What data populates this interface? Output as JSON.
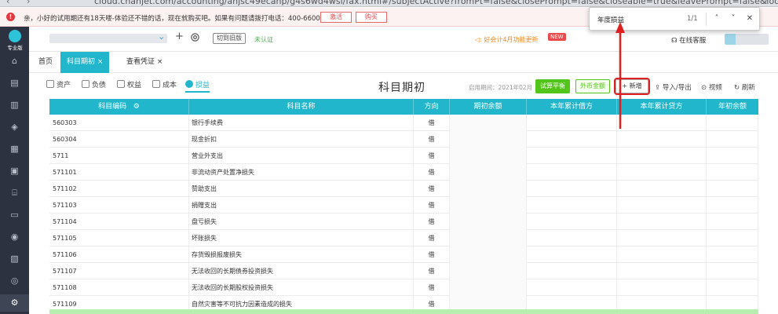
{
  "browser": {
    "url": "cloud.chanjet.com/accounting/anjsc49ecanp/g4s6wd4wsl/fax.html#/subjectActive?fromPt=false&closePrompt=false&closeable=true&leavePrompt=false&lock=false&pageId=subject&pa..."
  },
  "notice": {
    "text": "亲，小好的试用期还有18天喽-体验还不错的话，现在就购买吧。如果有问题请拨打电话：400-6600-566",
    "activate_label": "激活",
    "buy_label": "购买"
  },
  "sidebar": {
    "logo_label": "专业版"
  },
  "header": {
    "switch_label": "切到旧版",
    "unverified_label": "未认证",
    "promo_text": "好会计4月功能更新",
    "new_badge": "NEW",
    "support_label": "在线客服"
  },
  "tabs": [
    {
      "label": "首页"
    },
    {
      "label": "科目期初"
    },
    {
      "label": "查看凭证"
    }
  ],
  "subtabs": [
    {
      "label": "资产"
    },
    {
      "label": "负债"
    },
    {
      "label": "权益"
    },
    {
      "label": "成本"
    },
    {
      "label": "损益"
    }
  ],
  "toolbar": {
    "title": "科目期初",
    "period": "启用期间：2021年02月",
    "trial_balance_label": "试算平衡",
    "foreign_currency_label": "外币金额",
    "add_label": "+ 新增",
    "import_export_label": "导入/导出",
    "video_label": "视频",
    "refresh_label": "刷新"
  },
  "table": {
    "columns": [
      "科目编码",
      "科目名称",
      "方向",
      "期初余额",
      "本年累计借方",
      "本年累计贷方",
      "年初余额"
    ],
    "rows": [
      {
        "code": "560303",
        "name": "银行手续费",
        "dir": "借"
      },
      {
        "code": "560304",
        "name": "现金折扣",
        "dir": "借"
      },
      {
        "code": "5711",
        "name": "营业外支出",
        "dir": "借"
      },
      {
        "code": "571101",
        "name": "非流动资产处置净损失",
        "dir": "借"
      },
      {
        "code": "571102",
        "name": "赞助支出",
        "dir": "借"
      },
      {
        "code": "571103",
        "name": "捐赠支出",
        "dir": "借"
      },
      {
        "code": "571104",
        "name": "盘亏损失",
        "dir": "借"
      },
      {
        "code": "571105",
        "name": "坏账损失",
        "dir": "借"
      },
      {
        "code": "571106",
        "name": "存货毁损报废损失",
        "dir": "借"
      },
      {
        "code": "571107",
        "name": "无法收回的长期债券投资损失",
        "dir": "借"
      },
      {
        "code": "571108",
        "name": "无法收回的长期股权投资损失",
        "dir": "借"
      },
      {
        "code": "571109",
        "name": "自然灾害等不可抗力因素造成的损失",
        "dir": "借"
      }
    ]
  },
  "findbar": {
    "query": "年度损益",
    "count": "1/1"
  },
  "colors": {
    "accent": "#21b6cc",
    "sidebar": "#2c3240",
    "green": "#52c41a",
    "annotation": "#e02020"
  }
}
